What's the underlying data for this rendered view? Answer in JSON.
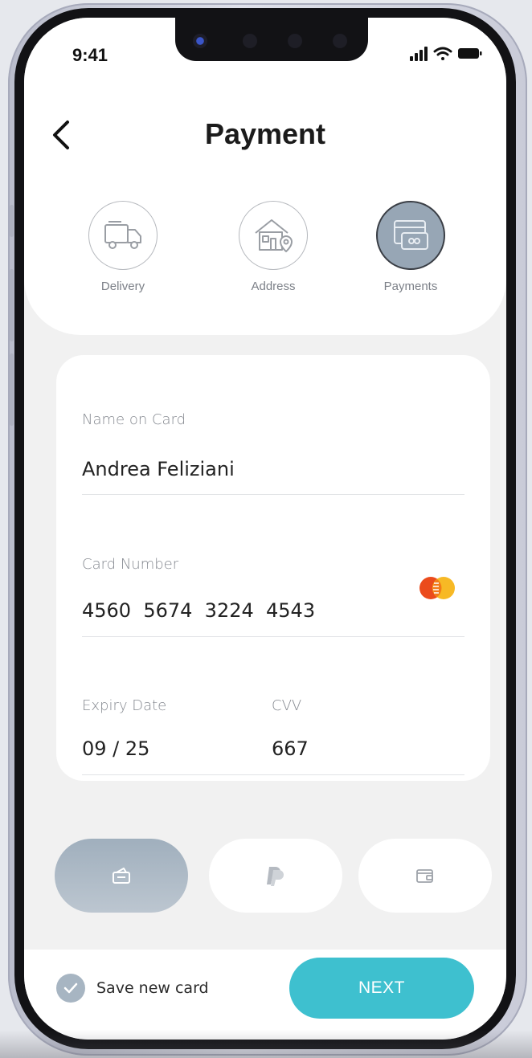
{
  "status_bar": {
    "time": "9:41"
  },
  "header": {
    "title": "Payment"
  },
  "steps": [
    {
      "label": "Delivery",
      "icon": "truck-icon",
      "active": false
    },
    {
      "label": "Address",
      "icon": "house-location-icon",
      "active": false
    },
    {
      "label": "Payments",
      "icon": "payment-card-icon",
      "active": true
    }
  ],
  "form": {
    "name_label": "Name on Card",
    "name_value": "Andrea Feliziani",
    "number_label": "Card Number",
    "number_value": "4560  5674  3224  4543",
    "card_brand_icon": "mastercard-icon",
    "expiry_label": "Expiry Date",
    "expiry_value": "09 / 25",
    "cvv_label": "CVV",
    "cvv_value": "667"
  },
  "payment_methods": [
    {
      "icon": "card-icon",
      "selected": true
    },
    {
      "icon": "paypal-icon",
      "selected": false
    },
    {
      "icon": "wallet-icon",
      "selected": false
    }
  ],
  "footer": {
    "save_label": "Save new card",
    "save_checked": true,
    "next_label": "NEXT"
  },
  "colors": {
    "accent": "#3ec0cf",
    "selected_gray": "#97a6b5",
    "background": "#f1f1f1"
  }
}
